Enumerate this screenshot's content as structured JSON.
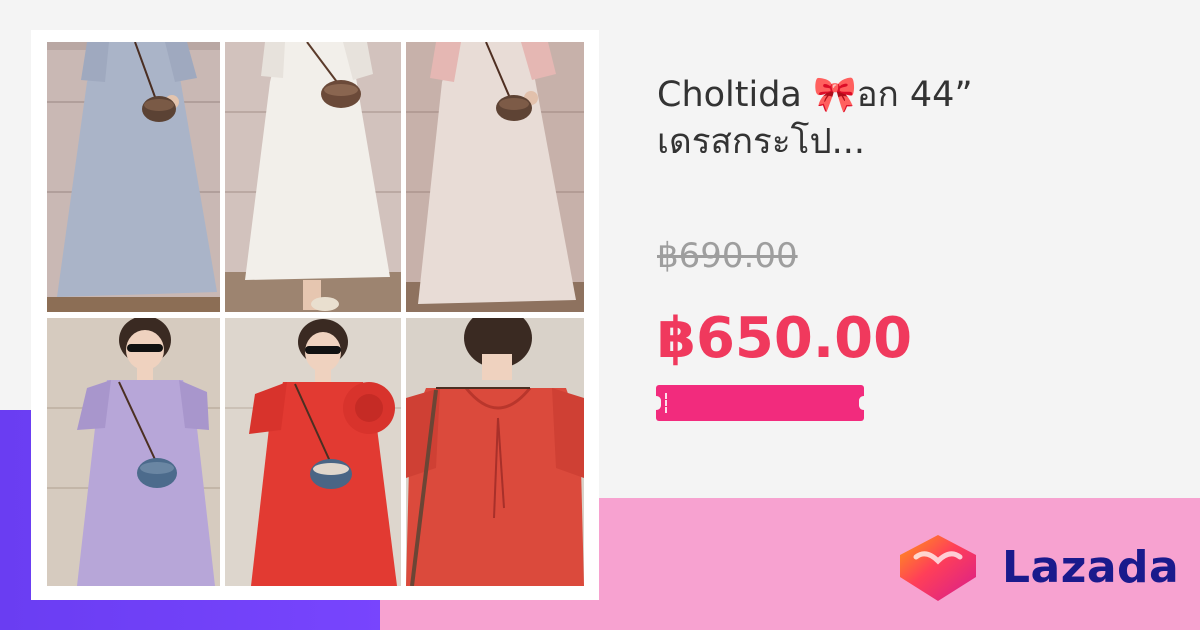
{
  "product": {
    "title_line1": "Choltida 🎀อก 44”",
    "title_line2": "เดรสกระโป...",
    "original_price": "฿690.00",
    "sale_price": "฿650.00"
  },
  "brand": {
    "name": "Lazada",
    "logo_icon": "lazada-heart-icon",
    "name_color": "#1a1a8c"
  },
  "colors": {
    "sale_price": "#f0395d",
    "voucher": "#f22b7d",
    "accent_purple": "#6a3df2",
    "accent_pink": "#f7a2d0"
  },
  "gallery": {
    "images": [
      {
        "name": "dress-light-blue-front",
        "dress_color": "#aab4c8"
      },
      {
        "name": "dress-white-front",
        "dress_color": "#f2efea"
      },
      {
        "name": "dress-pink-front",
        "dress_color": "#e8dcd6"
      },
      {
        "name": "dress-lavender-model",
        "dress_color": "#b7a6d8"
      },
      {
        "name": "dress-red-model",
        "dress_color": "#e23a32"
      },
      {
        "name": "dress-red-back-detail",
        "dress_color": "#db4a3c"
      }
    ]
  }
}
